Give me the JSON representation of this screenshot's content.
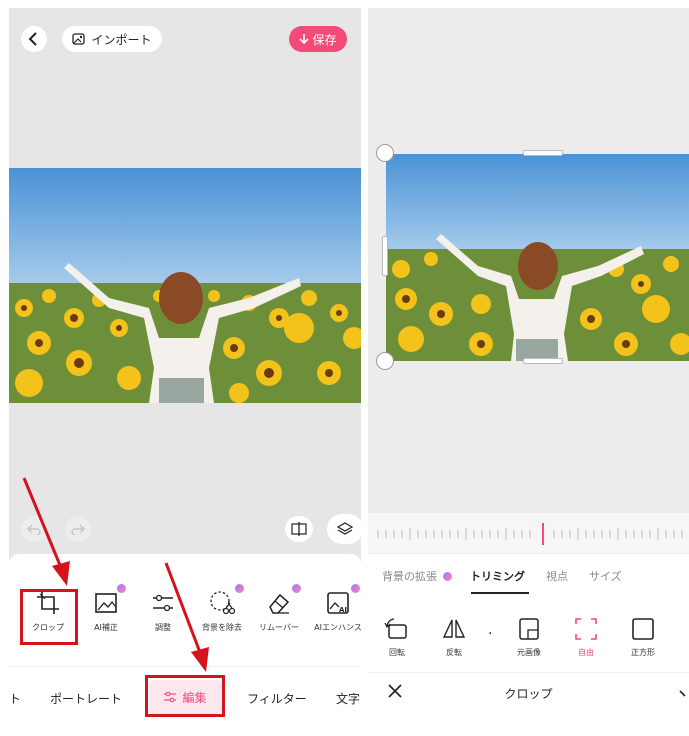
{
  "left_screen": {
    "back_label": "<",
    "import_label": "インポート",
    "save_label": "保存",
    "tools": [
      {
        "label": "クロップ",
        "icon": "crop-icon"
      },
      {
        "label": "AI補正",
        "icon": "image-enhance-icon"
      },
      {
        "label": "調整",
        "icon": "sliders-icon"
      },
      {
        "label": "背景を除去",
        "icon": "scissors-icon"
      },
      {
        "label": "リムーバー",
        "icon": "eraser-icon"
      },
      {
        "label": "AIエンハンス",
        "icon": "ai-enhance-icon"
      }
    ],
    "nav_tabs": [
      {
        "label": "ト"
      },
      {
        "label": "ポートレート"
      },
      {
        "label": "編集"
      },
      {
        "label": "フィルター"
      },
      {
        "label": "文字"
      }
    ]
  },
  "right_screen": {
    "tabs": [
      {
        "label": "背景の拡張"
      },
      {
        "label": "トリミング"
      },
      {
        "label": "視点"
      },
      {
        "label": "サイズ"
      }
    ],
    "tools": [
      {
        "label": "回転",
        "icon": "rotate-icon"
      },
      {
        "label": "反転",
        "icon": "flip-icon"
      },
      {
        "label": "元画像",
        "icon": "original-ratio-icon"
      },
      {
        "label": "自由",
        "icon": "free-crop-icon"
      },
      {
        "label": "正方形",
        "icon": "square-icon"
      }
    ],
    "dot_label": ".",
    "bottom_title": "クロップ",
    "close_label": "✕"
  },
  "colors": {
    "accent": "#f44a78",
    "annotation": "#d3131d",
    "sky": "#5b9fd9",
    "sunflower": "#f3c21b"
  }
}
